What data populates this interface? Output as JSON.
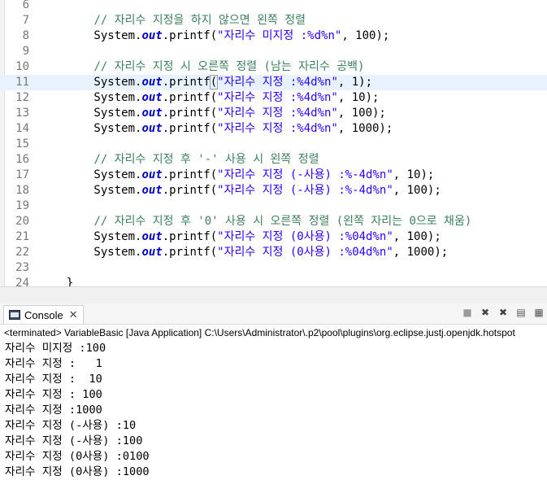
{
  "editor": {
    "lines": [
      {
        "no": "6",
        "parts": []
      },
      {
        "no": "7",
        "parts": [
          {
            "t": "        "
          },
          {
            "t": "// 자리수 지정을 하지 않으면 왼쪽 정렬",
            "c": "cm"
          }
        ]
      },
      {
        "no": "8",
        "parts": [
          {
            "t": "        System."
          },
          {
            "t": "out",
            "c": "fld"
          },
          {
            "t": ".printf("
          },
          {
            "t": "\"자리수 미지정 :%d%n\"",
            "c": "str"
          },
          {
            "t": ", 100);"
          }
        ]
      },
      {
        "no": "9",
        "parts": []
      },
      {
        "no": "10",
        "parts": [
          {
            "t": "        "
          },
          {
            "t": "// 자리수 지정 시 오른쪽 정렬 (남는 자리수 공백)",
            "c": "cm"
          }
        ]
      },
      {
        "no": "11",
        "current": true,
        "parts": [
          {
            "t": "        System."
          },
          {
            "t": "out",
            "c": "fld"
          },
          {
            "t": ".printf"
          },
          {
            "t": "(",
            "c": "bracket"
          },
          {
            "t": "\"자리수 지정 :%4d%n\"",
            "c": "str"
          },
          {
            "t": ", 1);"
          }
        ]
      },
      {
        "no": "12",
        "parts": [
          {
            "t": "        System."
          },
          {
            "t": "out",
            "c": "fld"
          },
          {
            "t": ".printf("
          },
          {
            "t": "\"자리수 지정 :%4d%n\"",
            "c": "str"
          },
          {
            "t": ", 10);"
          }
        ]
      },
      {
        "no": "13",
        "parts": [
          {
            "t": "        System."
          },
          {
            "t": "out",
            "c": "fld"
          },
          {
            "t": ".printf("
          },
          {
            "t": "\"자리수 지정 :%4d%n\"",
            "c": "str"
          },
          {
            "t": ", 100);"
          }
        ]
      },
      {
        "no": "14",
        "parts": [
          {
            "t": "        System."
          },
          {
            "t": "out",
            "c": "fld"
          },
          {
            "t": ".printf("
          },
          {
            "t": "\"자리수 지정 :%4d%n\"",
            "c": "str"
          },
          {
            "t": ", 1000);"
          }
        ]
      },
      {
        "no": "15",
        "parts": []
      },
      {
        "no": "16",
        "parts": [
          {
            "t": "        "
          },
          {
            "t": "// 자리수 지정 후 '-' 사용 시 왼쪽 정렬",
            "c": "cm"
          }
        ]
      },
      {
        "no": "17",
        "parts": [
          {
            "t": "        System."
          },
          {
            "t": "out",
            "c": "fld"
          },
          {
            "t": ".printf("
          },
          {
            "t": "\"자리수 지정 (-사용) :%-4d%n\"",
            "c": "str"
          },
          {
            "t": ", 10);"
          }
        ]
      },
      {
        "no": "18",
        "parts": [
          {
            "t": "        System."
          },
          {
            "t": "out",
            "c": "fld"
          },
          {
            "t": ".printf("
          },
          {
            "t": "\"자리수 지정 (-사용) :%-4d%n\"",
            "c": "str"
          },
          {
            "t": ", 100);"
          }
        ]
      },
      {
        "no": "19",
        "parts": []
      },
      {
        "no": "20",
        "parts": [
          {
            "t": "        "
          },
          {
            "t": "// 자리수 지정 후 '0' 사용 시 오른쪽 정렬 (왼쪽 자리는 0으로 채움)",
            "c": "cm"
          }
        ]
      },
      {
        "no": "21",
        "parts": [
          {
            "t": "        System."
          },
          {
            "t": "out",
            "c": "fld"
          },
          {
            "t": ".printf("
          },
          {
            "t": "\"자리수 지정 (0사용) :%04d%n\"",
            "c": "str"
          },
          {
            "t": ", 100);"
          }
        ]
      },
      {
        "no": "22",
        "parts": [
          {
            "t": "        System."
          },
          {
            "t": "out",
            "c": "fld"
          },
          {
            "t": ".printf("
          },
          {
            "t": "\"자리수 지정 (0사용) :%04d%n\"",
            "c": "str"
          },
          {
            "t": ", 1000);"
          }
        ]
      },
      {
        "no": "23",
        "parts": []
      },
      {
        "no": "24",
        "parts": [
          {
            "t": "    }"
          }
        ]
      }
    ]
  },
  "console": {
    "tab_label": "Console",
    "close_glyph": "✕",
    "toolbar": {
      "terminate": "■",
      "remove": "✖",
      "remove_all": "✖",
      "clear": "▤",
      "scroll_lock": "▦"
    },
    "status": "<terminated> VariableBasic [Java Application] C:\\Users\\Administrator\\.p2\\pool\\plugins\\org.eclipse.justj.openjdk.hotspot",
    "output": [
      "자리수 미지정 :100",
      "자리수 지정 :   1",
      "자리수 지정 :  10",
      "자리수 지정 : 100",
      "자리수 지정 :1000",
      "자리수 지정 (-사용) :10",
      "자리수 지정 (-사용) :100",
      "자리수 지정 (0사용) :0100",
      "자리수 지정 (0사용) :1000"
    ]
  }
}
